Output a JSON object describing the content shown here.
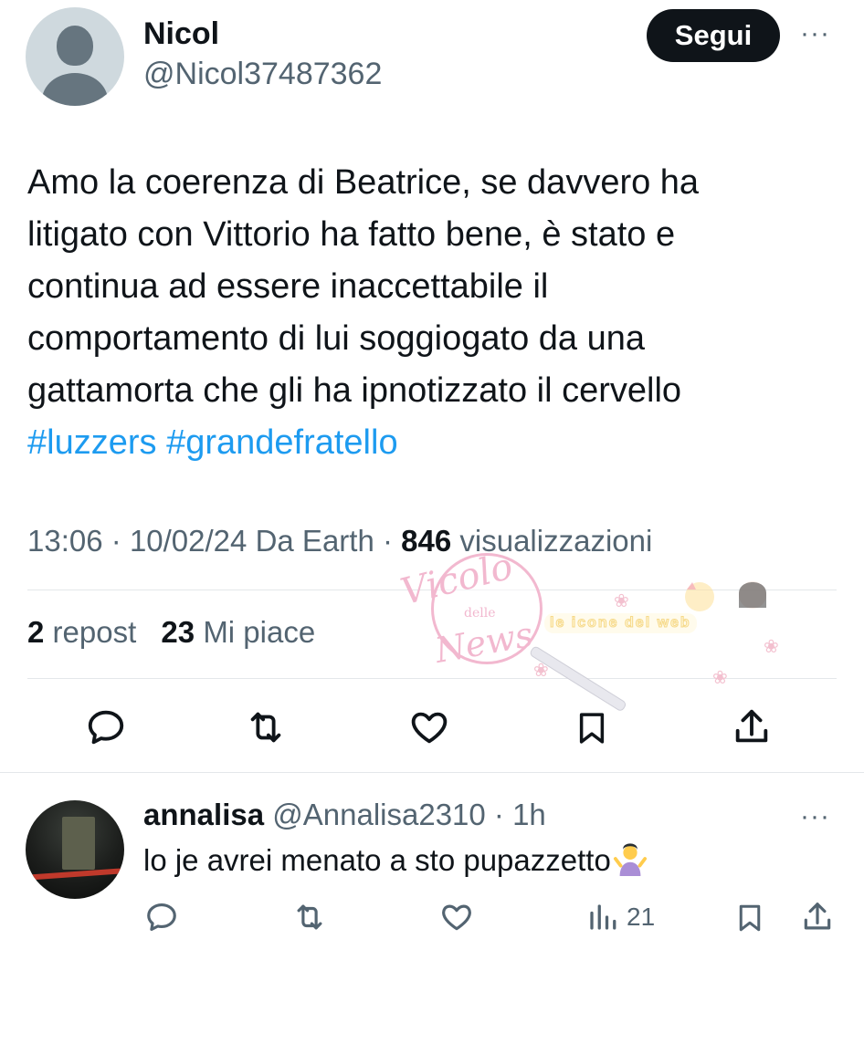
{
  "tweet": {
    "author_name": "Nicol",
    "author_handle": "@Nicol37487362",
    "follow_label": "Segui",
    "more_label": "···",
    "text_lines": [
      "Amo la coerenza di Beatrice, se davvero ha",
      "litigato con Vittorio ha fatto bene, è stato e",
      "continua ad essere inaccettabile il",
      "comportamento di lui soggiogato da una",
      "gattamorta che gli ha ipnotizzato il cervello"
    ],
    "hashtags": [
      "#luzzers",
      "#grandefratello"
    ],
    "time": "13:06",
    "date": "10/02/24",
    "source": "Da Earth",
    "separator": "·",
    "views_count": "846",
    "views_label": "visualizzazioni",
    "reposts_count": "2",
    "reposts_label": "repost",
    "likes_count": "23",
    "likes_label": "Mi piace",
    "actions": [
      "reply-icon",
      "repost-icon",
      "like-icon",
      "bookmark-icon",
      "share-icon"
    ]
  },
  "reply": {
    "name": "annalisa",
    "handle": "@Annalisa2310",
    "time": "· 1h",
    "text": "lo je avrei menato a sto pupazzetto",
    "emoji": "person-shrugging-emoji",
    "more_label": "···",
    "views_count": "21",
    "actions": [
      "reply-icon",
      "repost-icon",
      "like-icon",
      "views-icon",
      "bookmark-icon",
      "share-icon"
    ]
  },
  "watermark": {
    "line1": "Vicolo",
    "line2": "delle",
    "line3": "News",
    "banner": "le icone del web"
  },
  "colors": {
    "text": "#0f1419",
    "secondary": "#536471",
    "link": "#1d9bf0",
    "follow_bg": "#0f1419",
    "divider": "#e4e7ea",
    "watermark_pink": "#f2b8cf"
  }
}
